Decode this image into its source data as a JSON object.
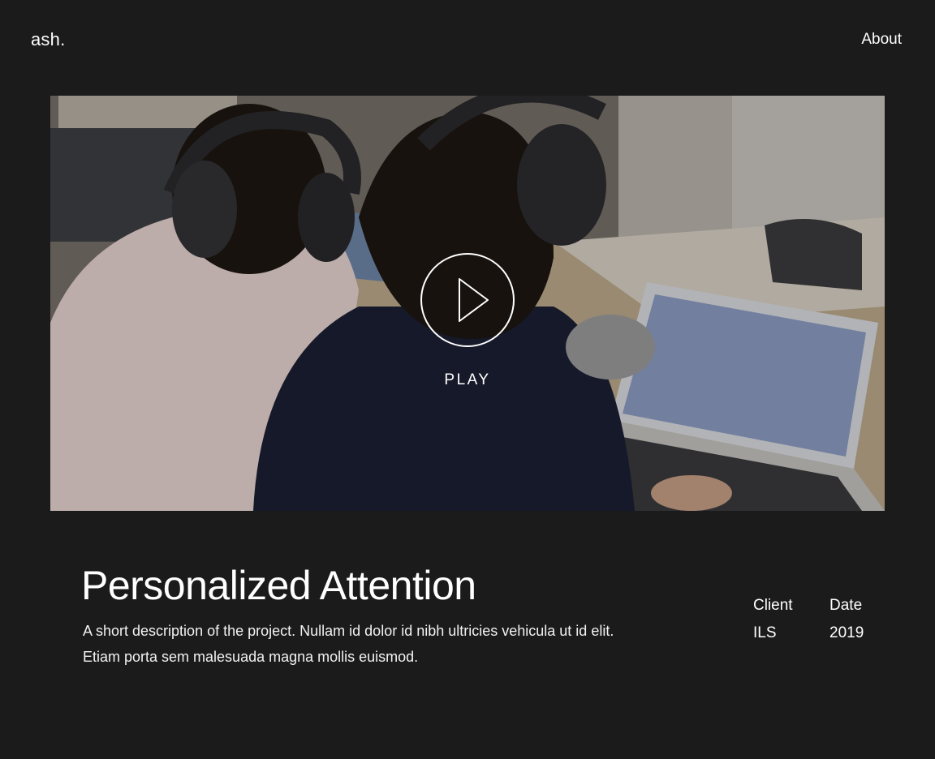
{
  "header": {
    "logo": "ash.",
    "nav_about": "About"
  },
  "hero": {
    "play_label": "PLAY"
  },
  "project": {
    "title": "Personalized Attention",
    "description": "A short description of the project. Nullam id dolor id nibh ultricies vehicula ut id elit. Etiam porta sem malesuada magna mollis euismod.",
    "meta": [
      {
        "label": "Client",
        "value": "ILS"
      },
      {
        "label": "Date",
        "value": "2019"
      }
    ]
  },
  "colors": {
    "background": "#1b1b1b",
    "text": "#ffffff"
  }
}
